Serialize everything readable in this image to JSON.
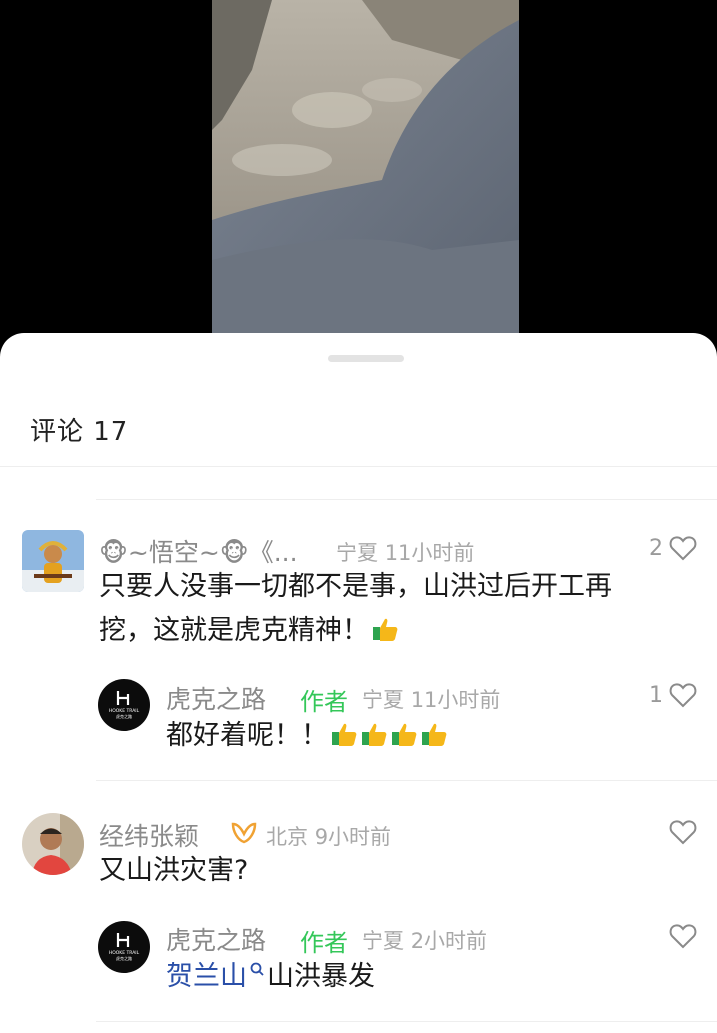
{
  "comments_header": {
    "label": "评论 17"
  },
  "comments": [
    {
      "name": "🐵~悟空~🐵《...",
      "location": "宁夏",
      "time": "11小时前",
      "likes": "2",
      "text_line1": "只要人没事一切都不是事，山洪过后开工再",
      "text_line2": "挖，这就是虎克精神！",
      "reply": {
        "name": "虎克之路",
        "author_tag": "作者",
        "location": "宁夏",
        "time": "11小时前",
        "likes": "1",
        "text": "都好着呢！！"
      }
    },
    {
      "name": "经纬张颖",
      "location": "北京",
      "time": "9小时前",
      "likes": "",
      "text": "又山洪灾害?",
      "reply": {
        "name": "虎克之路",
        "author_tag": "作者",
        "location": "宁夏",
        "time": "2小时前",
        "likes": "",
        "text_link": "贺兰山",
        "text_rest": "山洪暴发"
      }
    }
  ],
  "avatar_logo_text": {
    "top": "HOOKE TRAIL",
    "bottom": "虎克之路"
  },
  "colors": {
    "author_tag": "#34c759",
    "link": "#2a4fa8",
    "thumb": "#f5b719",
    "thumb_cuff": "#2ea44f"
  },
  "icons": [
    "heart-outline-icon",
    "thumbs-up-emoji",
    "search-mini-icon",
    "monkey-emoji",
    "badge-icon"
  ]
}
